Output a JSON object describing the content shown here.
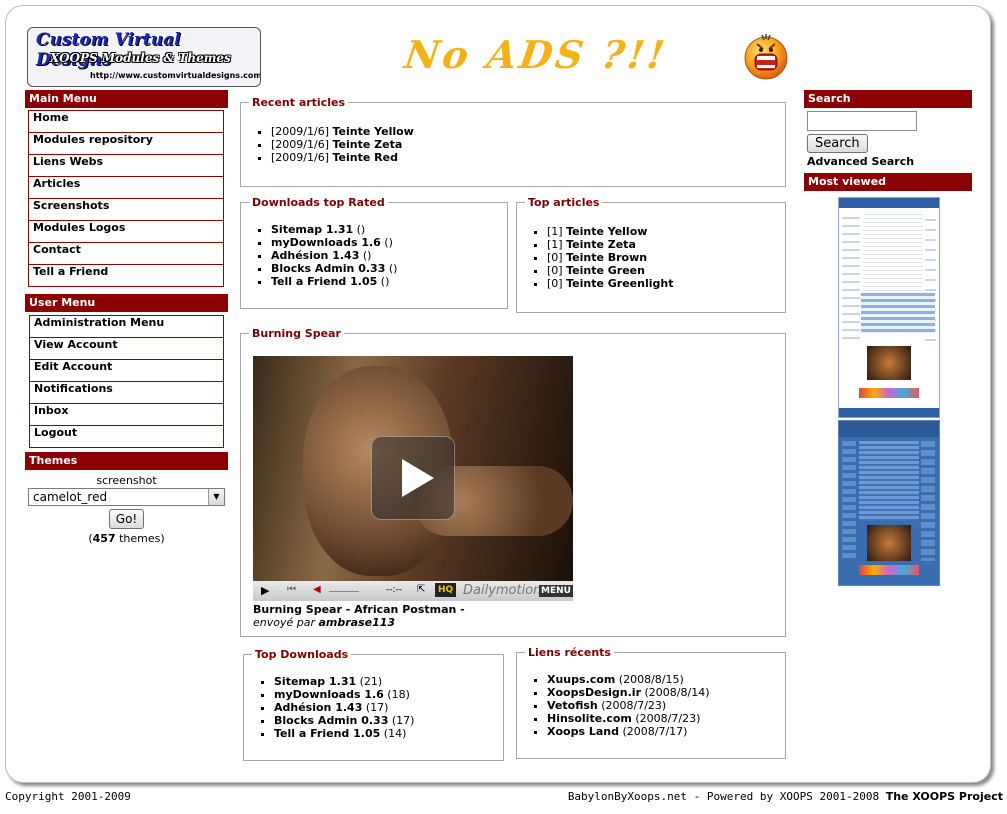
{
  "header": {
    "logo_line1": "Custom Virtual Designs",
    "logo_line2": "XOOPS Modules & Themes",
    "logo_url": "http://www.customvirtualdesigns.com",
    "banner_text": "No ADS ?!!",
    "smiley_icon": "yelling-face-icon"
  },
  "main_menu": {
    "title": "Main Menu",
    "items": [
      "Home",
      "Modules repository",
      "Liens Webs",
      "Articles",
      "Screenshots",
      "Modules Logos",
      "Contact",
      "Tell a Friend"
    ]
  },
  "user_menu": {
    "title": "User Menu",
    "items": [
      "Administration Menu",
      "View Account",
      "Edit Account",
      "Notifications",
      "Inbox",
      "Logout"
    ]
  },
  "themes": {
    "title": "Themes",
    "label": "screenshot",
    "selected": "camelot_red",
    "go_label": "Go!",
    "count_prefix": "(",
    "count": "457",
    "count_suffix": " themes)"
  },
  "recent_articles": {
    "title": "Recent articles",
    "items": [
      {
        "date": "[2009/1/6]",
        "title": "Teinte Yellow"
      },
      {
        "date": "[2009/1/6]",
        "title": "Teinte Zeta"
      },
      {
        "date": "[2009/1/6]",
        "title": "Teinte Red"
      }
    ]
  },
  "downloads_top_rated": {
    "title": "Downloads top Rated",
    "items": [
      {
        "name": "Sitemap 1.31",
        "extra": " ()"
      },
      {
        "name": "myDownloads 1.6",
        "extra": " ()"
      },
      {
        "name": "Adhésion 1.43",
        "extra": " ()"
      },
      {
        "name": "Blocks Admin 0.33",
        "extra": " ()"
      },
      {
        "name": "Tell a Friend 1.05",
        "extra": " ()"
      }
    ]
  },
  "top_articles": {
    "title": "Top articles",
    "items": [
      {
        "count": "[1]",
        "title": "Teinte Yellow"
      },
      {
        "count": "[1]",
        "title": "Teinte Zeta"
      },
      {
        "count": "[0]",
        "title": "Teinte Brown"
      },
      {
        "count": "[0]",
        "title": "Teinte Green"
      },
      {
        "count": "[0]",
        "title": "Teinte Greenlight"
      }
    ]
  },
  "video_block": {
    "title": "Burning Spear",
    "video_title": "Burning Spear - African Postman -",
    "sent_by_label": "envoyé par ",
    "sent_by_user": "ambrase113",
    "player": {
      "time": "--:--",
      "hq_label": "HQ",
      "brand": "Dailymotion",
      "menu_label": "MENU"
    }
  },
  "top_downloads": {
    "title": "Top Downloads",
    "items": [
      {
        "name": "Sitemap 1.31",
        "extra": " (21)"
      },
      {
        "name": "myDownloads 1.6",
        "extra": " (18)"
      },
      {
        "name": "Adhésion 1.43",
        "extra": " (17)"
      },
      {
        "name": "Blocks Admin 0.33",
        "extra": " (17)"
      },
      {
        "name": "Tell a Friend 1.05",
        "extra": " (14)"
      }
    ]
  },
  "recent_links": {
    "title": "Liens récents",
    "items": [
      {
        "name": "Xuups.com",
        "date": " (2008/8/15)"
      },
      {
        "name": "XoopsDesign.ir",
        "date": " (2008/8/14)"
      },
      {
        "name": "Vetofish",
        "date": " (2008/7/23)"
      },
      {
        "name": "Hinsolite.com",
        "date": " (2008/7/23)"
      },
      {
        "name": "Xoops Land",
        "date": " (2008/7/17)"
      }
    ]
  },
  "search": {
    "title": "Search",
    "value": "",
    "button_label": "Search",
    "advanced_label": "Advanced Search"
  },
  "most_viewed": {
    "title": "Most viewed"
  },
  "footer": {
    "copyright": "Copyright 2001-2009",
    "powered": "BabylonByXoops.net - Powered by XOOPS 2001-2008 ",
    "project": "The XOOPS Project"
  },
  "colors": {
    "accent": "#8b0000",
    "legend": "#7a0000",
    "banner": "#f2b21a"
  }
}
